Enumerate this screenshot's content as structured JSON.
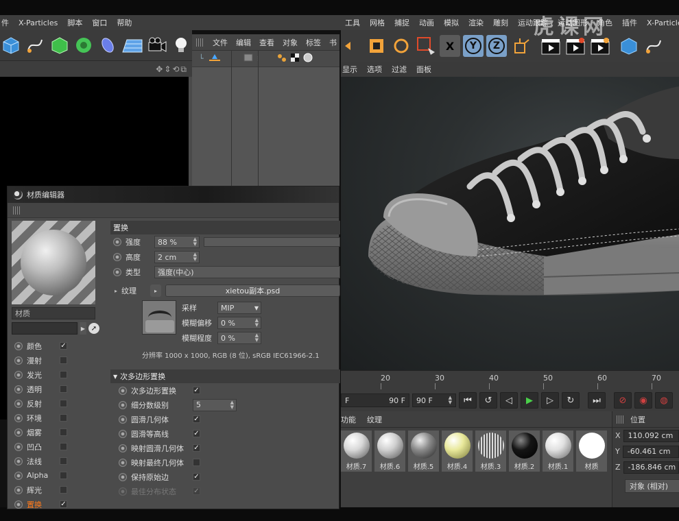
{
  "left_menu": [
    "件",
    "X-Particles",
    "脚本",
    "窗口",
    "帮助"
  ],
  "left_toolbar_icons": [
    "cube-icon",
    "spline-pen-icon",
    "nurbs-icon",
    "array-icon",
    "deformer-icon",
    "floor-icon",
    "camera-icon",
    "light-icon"
  ],
  "object_manager": {
    "tabs": [
      "文件",
      "编辑",
      "查看",
      "对象",
      "标签",
      "书"
    ]
  },
  "right_menu": [
    "工具",
    "网格",
    "捕捉",
    "动画",
    "模拟",
    "渲染",
    "雕刻",
    "运动跟踪",
    "运动图形",
    "角色",
    "插件",
    "X-Particles"
  ],
  "axis_buttons": {
    "x": "X",
    "y": "Y",
    "z": "Z"
  },
  "viewport_menu": [
    "显示",
    "选项",
    "过滤",
    "面板"
  ],
  "watermark": "虎课网",
  "timeline": {
    "ticks": [
      "20",
      "30",
      "40",
      "50",
      "60",
      "70"
    ],
    "start_field": "F",
    "end_field": "90 F",
    "max_field": "90 F"
  },
  "material_manager": {
    "menu": [
      "功能",
      "纹理"
    ],
    "materials": [
      {
        "name": "材质.7",
        "color": "#d8d8d8"
      },
      {
        "name": "材质.6",
        "color": "#cfcfcf"
      },
      {
        "name": "材质.5",
        "color": "#8a8a8a"
      },
      {
        "name": "材质.4",
        "color": "#e8e89a"
      },
      {
        "name": "材质.3",
        "color": "#a0a0a0"
      },
      {
        "name": "材质.2",
        "color": "#151515"
      },
      {
        "name": "材质.1",
        "color": "#e0e0e0"
      },
      {
        "name": "材质",
        "color": "#ffffff"
      }
    ]
  },
  "coordinates": {
    "title": "位置",
    "x_label": "X",
    "x_value": "110.092 cm",
    "y_label": "Y",
    "y_value": "-60.461 cm",
    "z_label": "Z",
    "z_value": "-186.846 cm",
    "mode": "对象 (相对)"
  },
  "material_editor": {
    "title": "材质编辑器",
    "material_name": "材质",
    "channels": [
      {
        "label": "颜色",
        "checked": true,
        "active": false
      },
      {
        "label": "漫射",
        "checked": false,
        "active": false
      },
      {
        "label": "发光",
        "checked": false,
        "active": false
      },
      {
        "label": "透明",
        "checked": false,
        "active": false
      },
      {
        "label": "反射",
        "checked": false,
        "active": false
      },
      {
        "label": "环境",
        "checked": false,
        "active": false
      },
      {
        "label": "烟雾",
        "checked": false,
        "active": false
      },
      {
        "label": "凹凸",
        "checked": false,
        "active": false
      },
      {
        "label": "法线",
        "checked": false,
        "active": false
      },
      {
        "label": "Alpha",
        "checked": false,
        "active": false
      },
      {
        "label": "辉光",
        "checked": false,
        "active": false
      },
      {
        "label": "置换",
        "checked": true,
        "active": true
      }
    ],
    "section_title": "置换",
    "strength_label": "强度",
    "strength_value": "88 %",
    "height_label": "高度",
    "height_value": "2 cm",
    "type_label": "类型",
    "type_value": "强度(中心)",
    "texture_label": "纹理",
    "texture_file": "xietou副本.psd",
    "sampling_label": "采样",
    "sampling_value": "MIP",
    "blur_offset_label": "模糊偏移",
    "blur_offset_value": "0 %",
    "blur_scale_label": "模糊程度",
    "blur_scale_value": "0 %",
    "resolution": "分辨率 1000 x 1000, RGB (8 位), sRGB IEC61966-2.1",
    "subpoly_title": "次多边形置换",
    "subpoly": [
      {
        "label": "次多边形置换",
        "type": "check",
        "checked": true
      },
      {
        "label": "细分数级别",
        "type": "number",
        "value": "5"
      },
      {
        "label": "圆滑几何体",
        "type": "check",
        "checked": true
      },
      {
        "label": "圆滑等高线",
        "type": "check",
        "checked": true
      },
      {
        "label": "映射圆滑几何体",
        "type": "check",
        "checked": true
      },
      {
        "label": "映射最终几何体",
        "type": "check",
        "checked": false
      },
      {
        "label": "保持原始边",
        "type": "check",
        "checked": true
      },
      {
        "label": "最佳分布状态",
        "type": "check",
        "checked": true,
        "dim": true
      }
    ]
  }
}
